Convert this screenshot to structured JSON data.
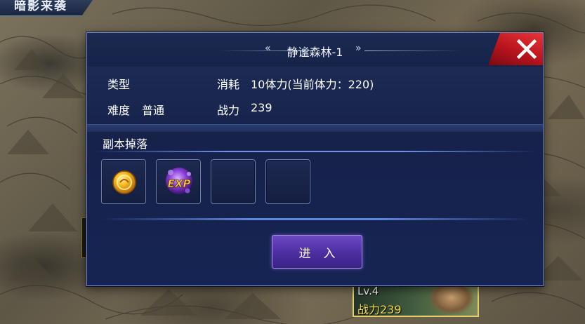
{
  "header_tab": {
    "label": "暗影来袭"
  },
  "dialog": {
    "title": "静谧森林-1",
    "info": {
      "type_label": "类型",
      "difficulty_label": "难度",
      "difficulty_value": "普通",
      "cost_label": "消耗",
      "cost_value": "10体力(当前体力：220)",
      "power_label": "战力",
      "power_value": "239"
    },
    "drops_title": "副本掉落",
    "drops": [
      {
        "icon": "gold-coin-icon"
      },
      {
        "icon": "exp-orb-icon",
        "text": "EXP"
      },
      {
        "icon": "empty"
      },
      {
        "icon": "empty"
      }
    ],
    "enter_label": "进入"
  },
  "stage_node": {
    "level": "Lv.4",
    "power": "战力239"
  },
  "colors": {
    "dialog_bg": "#16224a",
    "close_red": "#d3242b",
    "enter_purple": "#5a3bb8",
    "power_gold": "#f5d84a"
  }
}
